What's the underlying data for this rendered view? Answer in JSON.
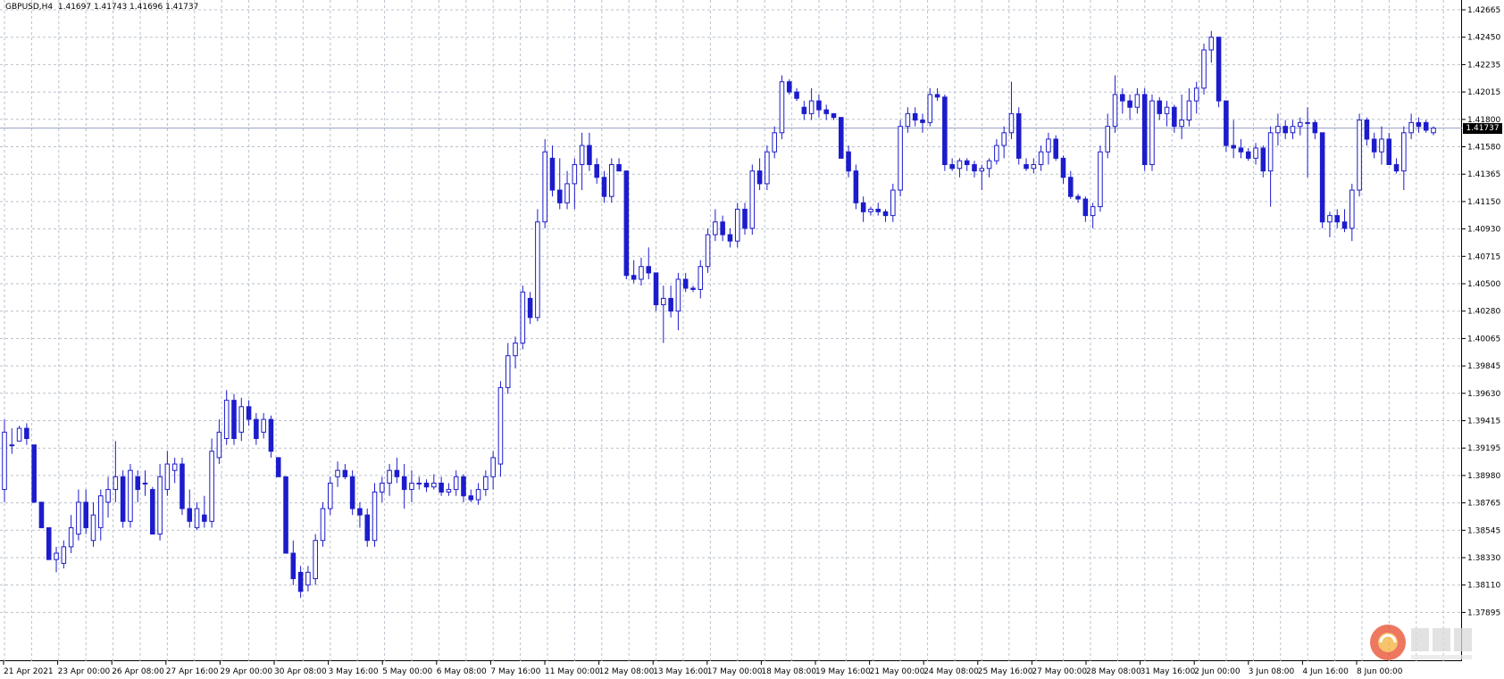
{
  "window": {
    "symbol": "GBPUSD,H4",
    "ohlc": "1.41697 1.41743 1.41696 1.41737",
    "symbol_line": "GBPUSD,H4  1.41697 1.41743 1.41696 1.41737"
  },
  "colors": {
    "candle": "#1c1ccc",
    "grid": "#b9c1cc",
    "bid_line": "#9aa3c8"
  },
  "price_axis": {
    "min": 1.378,
    "max": 1.4272,
    "ticks": [
      "1.42665",
      "1.42450",
      "1.42235",
      "1.42015",
      "1.41800",
      "1.41580",
      "1.41365",
      "1.41150",
      "1.40930",
      "1.40715",
      "1.40500",
      "1.40280",
      "1.40065",
      "1.39845",
      "1.39630",
      "1.39415",
      "1.39195",
      "1.38980",
      "1.38765",
      "1.38545",
      "1.38330",
      "1.38110",
      "1.37895"
    ]
  },
  "bid": {
    "value": 1.41737,
    "label": "1.41737"
  },
  "time_axis": {
    "labels": [
      "21 Apr 2021",
      "23 Apr 00:00",
      "26 Apr 08:00",
      "27 Apr 16:00",
      "29 Apr 00:00",
      "30 Apr 08:00",
      "3 May 16:00",
      "5 May 00:00",
      "6 May 08:00",
      "7 May 16:00",
      "11 May 00:00",
      "12 May 08:00",
      "13 May 16:00",
      "17 May 00:00",
      "18 May 08:00",
      "19 May 16:00",
      "21 May 00:00",
      "24 May 08:00",
      "25 May 16:00",
      "27 May 00:00",
      "28 May 08:00",
      "31 May 16:00",
      "2 Jun 00:00",
      "3 Jun 08:00",
      "4 Jun 16:00",
      "8 Jun 00:00"
    ]
  },
  "chart_data": {
    "type": "candlestick",
    "timeframe": "H4",
    "symbol": "GBPUSD",
    "candles": [
      [
        1.389,
        1.3945,
        1.388,
        1.3935
      ],
      [
        1.3925,
        1.3938,
        1.3918,
        1.3925
      ],
      [
        1.3928,
        1.394,
        1.3928,
        1.3938
      ],
      [
        1.3938,
        1.3942,
        1.3925,
        1.393
      ],
      [
        1.3925,
        1.3925,
        1.388,
        1.388
      ],
      [
        1.388,
        1.388,
        1.386,
        1.386
      ],
      [
        1.386,
        1.386,
        1.3835,
        1.3835
      ],
      [
        1.3835,
        1.3845,
        1.3825,
        1.384
      ],
      [
        1.3832,
        1.385,
        1.3828,
        1.3845
      ],
      [
        1.3845,
        1.387,
        1.384,
        1.386
      ],
      [
        1.3855,
        1.389,
        1.385,
        1.388
      ],
      [
        1.388,
        1.389,
        1.3855,
        1.386
      ],
      [
        1.385,
        1.388,
        1.3845,
        1.387
      ],
      [
        1.386,
        1.389,
        1.385,
        1.3885
      ],
      [
        1.388,
        1.39,
        1.3868,
        1.389
      ],
      [
        1.389,
        1.3928,
        1.388,
        1.39
      ],
      [
        1.39,
        1.3905,
        1.386,
        1.3865
      ],
      [
        1.3865,
        1.391,
        1.386,
        1.3905
      ],
      [
        1.39,
        1.3905,
        1.388,
        1.389
      ],
      [
        1.3895,
        1.3905,
        1.3885,
        1.3895
      ],
      [
        1.389,
        1.3892,
        1.3855,
        1.3855
      ],
      [
        1.3855,
        1.391,
        1.385,
        1.39
      ],
      [
        1.389,
        1.392,
        1.3885,
        1.391
      ],
      [
        1.3905,
        1.3915,
        1.3895,
        1.391
      ],
      [
        1.391,
        1.3915,
        1.387,
        1.3875
      ],
      [
        1.3875,
        1.389,
        1.386,
        1.3865
      ],
      [
        1.386,
        1.388,
        1.3858,
        1.3875
      ],
      [
        1.387,
        1.3885,
        1.386,
        1.3865
      ],
      [
        1.3865,
        1.393,
        1.386,
        1.392
      ],
      [
        1.3915,
        1.3945,
        1.391,
        1.3935
      ],
      [
        1.393,
        1.3968,
        1.3925,
        1.396
      ],
      [
        1.396,
        1.3965,
        1.3925,
        1.393
      ],
      [
        1.3935,
        1.3962,
        1.3928,
        1.3955
      ],
      [
        1.3955,
        1.396,
        1.394,
        1.3945
      ],
      [
        1.3945,
        1.395,
        1.3925,
        1.393
      ],
      [
        1.3935,
        1.395,
        1.393,
        1.3945
      ],
      [
        1.3945,
        1.3948,
        1.3915,
        1.392
      ],
      [
        1.3915,
        1.3915,
        1.39,
        1.39
      ],
      [
        1.39,
        1.39,
        1.384,
        1.384
      ],
      [
        1.384,
        1.385,
        1.3815,
        1.382
      ],
      [
        1.3825,
        1.383,
        1.3805,
        1.381
      ],
      [
        1.3815,
        1.383,
        1.381,
        1.3825
      ],
      [
        1.382,
        1.3855,
        1.3815,
        1.385
      ],
      [
        1.385,
        1.388,
        1.3845,
        1.3875
      ],
      [
        1.3875,
        1.39,
        1.387,
        1.3895
      ],
      [
        1.39,
        1.3912,
        1.3892,
        1.3905
      ],
      [
        1.3905,
        1.391,
        1.3898,
        1.39
      ],
      [
        1.39,
        1.3905,
        1.387,
        1.3875
      ],
      [
        1.3875,
        1.388,
        1.386,
        1.387
      ],
      [
        1.387,
        1.3875,
        1.3845,
        1.385
      ],
      [
        1.385,
        1.3895,
        1.3845,
        1.3888
      ],
      [
        1.3888,
        1.39,
        1.388,
        1.3895
      ],
      [
        1.3895,
        1.391,
        1.3885,
        1.3905
      ],
      [
        1.3905,
        1.3915,
        1.3895,
        1.39
      ],
      [
        1.39,
        1.391,
        1.3875,
        1.389
      ],
      [
        1.389,
        1.3905,
        1.388,
        1.3895
      ],
      [
        1.3895,
        1.39,
        1.389,
        1.3895
      ],
      [
        1.3895,
        1.3898,
        1.3888,
        1.3892
      ],
      [
        1.3892,
        1.3902,
        1.389,
        1.3895
      ],
      [
        1.3895,
        1.39,
        1.3885,
        1.3888
      ],
      [
        1.3888,
        1.3895,
        1.3885,
        1.389
      ],
      [
        1.389,
        1.3905,
        1.3885,
        1.39
      ],
      [
        1.39,
        1.3902,
        1.388,
        1.3885
      ],
      [
        1.3885,
        1.389,
        1.388,
        1.3882
      ],
      [
        1.3882,
        1.3895,
        1.3878,
        1.389
      ],
      [
        1.389,
        1.3905,
        1.3885,
        1.39
      ],
      [
        1.39,
        1.392,
        1.389,
        1.3915
      ],
      [
        1.391,
        1.3975,
        1.39,
        1.397
      ],
      [
        1.397,
        1.4005,
        1.3965,
        1.3995
      ],
      [
        1.3995,
        1.401,
        1.3985,
        1.4005
      ],
      [
        1.4005,
        1.405,
        1.4,
        1.4045
      ],
      [
        1.404,
        1.4045,
        1.402,
        1.4025
      ],
      [
        1.4025,
        1.411,
        1.4022,
        1.41
      ],
      [
        1.41,
        1.4165,
        1.4095,
        1.4155
      ],
      [
        1.415,
        1.416,
        1.412,
        1.4125
      ],
      [
        1.4125,
        1.415,
        1.411,
        1.4115
      ],
      [
        1.4115,
        1.414,
        1.411,
        1.413
      ],
      [
        1.413,
        1.415,
        1.411,
        1.4145
      ],
      [
        1.4145,
        1.417,
        1.4125,
        1.416
      ],
      [
        1.416,
        1.417,
        1.414,
        1.4145
      ],
      [
        1.4145,
        1.415,
        1.413,
        1.4135
      ],
      [
        1.4135,
        1.414,
        1.4115,
        1.412
      ],
      [
        1.412,
        1.415,
        1.4115,
        1.4145
      ],
      [
        1.4145,
        1.415,
        1.414,
        1.414
      ],
      [
        1.414,
        1.414,
        1.4055,
        1.4058
      ],
      [
        1.4058,
        1.407,
        1.4052,
        1.4055
      ],
      [
        1.4055,
        1.4072,
        1.405,
        1.4065
      ],
      [
        1.4065,
        1.408,
        1.4055,
        1.406
      ],
      [
        1.406,
        1.406,
        1.403,
        1.4035
      ],
      [
        1.4035,
        1.405,
        1.4005,
        1.404
      ],
      [
        1.404,
        1.405,
        1.4025,
        1.403
      ],
      [
        1.403,
        1.406,
        1.4015,
        1.4055
      ],
      [
        1.4055,
        1.406,
        1.4045,
        1.4048
      ],
      [
        1.4048,
        1.405,
        1.4045,
        1.4047
      ],
      [
        1.4047,
        1.407,
        1.404,
        1.4065
      ],
      [
        1.4065,
        1.4095,
        1.406,
        1.409
      ],
      [
        1.409,
        1.411,
        1.4085,
        1.41
      ],
      [
        1.41,
        1.4105,
        1.4085,
        1.409
      ],
      [
        1.409,
        1.4095,
        1.408,
        1.4085
      ],
      [
        1.4085,
        1.4115,
        1.408,
        1.411
      ],
      [
        1.411,
        1.4115,
        1.409,
        1.4095
      ],
      [
        1.4095,
        1.4145,
        1.409,
        1.414
      ],
      [
        1.414,
        1.415,
        1.4125,
        1.413
      ],
      [
        1.413,
        1.416,
        1.4125,
        1.4155
      ],
      [
        1.4155,
        1.4175,
        1.415,
        1.417
      ],
      [
        1.417,
        1.4215,
        1.4165,
        1.421
      ],
      [
        1.421,
        1.4212,
        1.42,
        1.4202
      ],
      [
        1.4202,
        1.4205,
        1.4195,
        1.4197
      ],
      [
        1.419,
        1.4195,
        1.418,
        1.4185
      ],
      [
        1.4185,
        1.4205,
        1.418,
        1.4195
      ],
      [
        1.4195,
        1.42,
        1.4182,
        1.4188
      ],
      [
        1.4188,
        1.4192,
        1.418,
        1.4185
      ],
      [
        1.4185,
        1.4185,
        1.418,
        1.4182
      ],
      [
        1.4182,
        1.4182,
        1.415,
        1.415
      ],
      [
        1.4155,
        1.416,
        1.4135,
        1.414
      ],
      [
        1.414,
        1.4145,
        1.411,
        1.4115
      ],
      [
        1.4115,
        1.412,
        1.41,
        1.4108
      ],
      [
        1.4108,
        1.4112,
        1.4105,
        1.411
      ],
      [
        1.411,
        1.4115,
        1.4105,
        1.4108
      ],
      [
        1.4108,
        1.411,
        1.41,
        1.4105
      ],
      [
        1.4105,
        1.413,
        1.41,
        1.4125
      ],
      [
        1.4125,
        1.418,
        1.412,
        1.4175
      ],
      [
        1.4175,
        1.419,
        1.417,
        1.4185
      ],
      [
        1.4185,
        1.419,
        1.4175,
        1.418
      ],
      [
        1.418,
        1.4185,
        1.417,
        1.4178
      ],
      [
        1.4178,
        1.4205,
        1.4175,
        1.42
      ],
      [
        1.42,
        1.4205,
        1.4195,
        1.4198
      ],
      [
        1.4198,
        1.42,
        1.414,
        1.4145
      ],
      [
        1.4145,
        1.415,
        1.414,
        1.4142
      ],
      [
        1.4142,
        1.415,
        1.4135,
        1.4148
      ],
      [
        1.4148,
        1.415,
        1.414,
        1.4145
      ],
      [
        1.4145,
        1.4148,
        1.4135,
        1.414
      ],
      [
        1.414,
        1.4145,
        1.4125,
        1.4142
      ],
      [
        1.4142,
        1.415,
        1.4135,
        1.4148
      ],
      [
        1.4148,
        1.4165,
        1.4145,
        1.416
      ],
      [
        1.416,
        1.4175,
        1.415,
        1.417
      ],
      [
        1.417,
        1.421,
        1.4165,
        1.4185
      ],
      [
        1.4185,
        1.419,
        1.4145,
        1.415
      ],
      [
        1.4145,
        1.415,
        1.414,
        1.4142
      ],
      [
        1.4142,
        1.415,
        1.4138,
        1.4145
      ],
      [
        1.4145,
        1.416,
        1.414,
        1.4155
      ],
      [
        1.4155,
        1.417,
        1.4145,
        1.4165
      ],
      [
        1.4165,
        1.4168,
        1.4148,
        1.415
      ],
      [
        1.415,
        1.4152,
        1.413,
        1.4135
      ],
      [
        1.4135,
        1.414,
        1.4118,
        1.412
      ],
      [
        1.412,
        1.4122,
        1.4115,
        1.4118
      ],
      [
        1.4118,
        1.412,
        1.41,
        1.4105
      ],
      [
        1.4105,
        1.4115,
        1.4095,
        1.4112
      ],
      [
        1.4112,
        1.416,
        1.4108,
        1.4155
      ],
      [
        1.4155,
        1.4185,
        1.415,
        1.4175
      ],
      [
        1.4175,
        1.4215,
        1.417,
        1.42
      ],
      [
        1.42,
        1.4205,
        1.4185,
        1.4195
      ],
      [
        1.4195,
        1.42,
        1.418,
        1.419
      ],
      [
        1.419,
        1.4205,
        1.4185,
        1.42
      ],
      [
        1.42,
        1.4205,
        1.414,
        1.4145
      ],
      [
        1.4145,
        1.42,
        1.414,
        1.4195
      ],
      [
        1.4195,
        1.4198,
        1.418,
        1.4185
      ],
      [
        1.4185,
        1.4195,
        1.4175,
        1.419
      ],
      [
        1.419,
        1.4192,
        1.417,
        1.4175
      ],
      [
        1.4175,
        1.42,
        1.4165,
        1.418
      ],
      [
        1.418,
        1.4205,
        1.4175,
        1.4195
      ],
      [
        1.4195,
        1.421,
        1.4185,
        1.4205
      ],
      [
        1.4205,
        1.424,
        1.42,
        1.4235
      ],
      [
        1.4235,
        1.425,
        1.4225,
        1.4245
      ],
      [
        1.4245,
        1.4245,
        1.419,
        1.4195
      ],
      [
        1.4195,
        1.4195,
        1.4155,
        1.416
      ],
      [
        1.416,
        1.418,
        1.415,
        1.4158
      ],
      [
        1.4158,
        1.4165,
        1.415,
        1.4155
      ],
      [
        1.4155,
        1.4158,
        1.4148,
        1.415
      ],
      [
        1.415,
        1.4162,
        1.4145,
        1.4158
      ],
      [
        1.4158,
        1.416,
        1.4135,
        1.414
      ],
      [
        1.414,
        1.4175,
        1.4112,
        1.417
      ],
      [
        1.417,
        1.4185,
        1.416,
        1.4175
      ],
      [
        1.4175,
        1.418,
        1.4165,
        1.417
      ],
      [
        1.417,
        1.418,
        1.4165,
        1.4175
      ],
      [
        1.4175,
        1.4182,
        1.4168,
        1.4178
      ],
      [
        1.4178,
        1.419,
        1.4135,
        1.4178
      ],
      [
        1.4178,
        1.418,
        1.4165,
        1.417
      ],
      [
        1.417,
        1.417,
        1.4095,
        1.41
      ],
      [
        1.41,
        1.4108,
        1.4088,
        1.4105
      ],
      [
        1.4105,
        1.411,
        1.4095,
        1.41
      ],
      [
        1.41,
        1.411,
        1.4092,
        1.4095
      ],
      [
        1.4095,
        1.413,
        1.4085,
        1.4125
      ],
      [
        1.4125,
        1.4185,
        1.412,
        1.418
      ],
      [
        1.418,
        1.4182,
        1.416,
        1.4165
      ],
      [
        1.4165,
        1.417,
        1.415,
        1.4155
      ],
      [
        1.4155,
        1.4175,
        1.4145,
        1.4165
      ],
      [
        1.4165,
        1.417,
        1.415,
        1.4145
      ],
      [
        1.4145,
        1.415,
        1.4138,
        1.414
      ],
      [
        1.414,
        1.4175,
        1.4125,
        1.417
      ],
      [
        1.417,
        1.4185,
        1.4165,
        1.4178
      ],
      [
        1.4178,
        1.4182,
        1.417,
        1.4175
      ],
      [
        1.4178,
        1.418,
        1.417,
        1.4172
      ],
      [
        1.417,
        1.4175,
        1.4168,
        1.41737
      ]
    ]
  }
}
